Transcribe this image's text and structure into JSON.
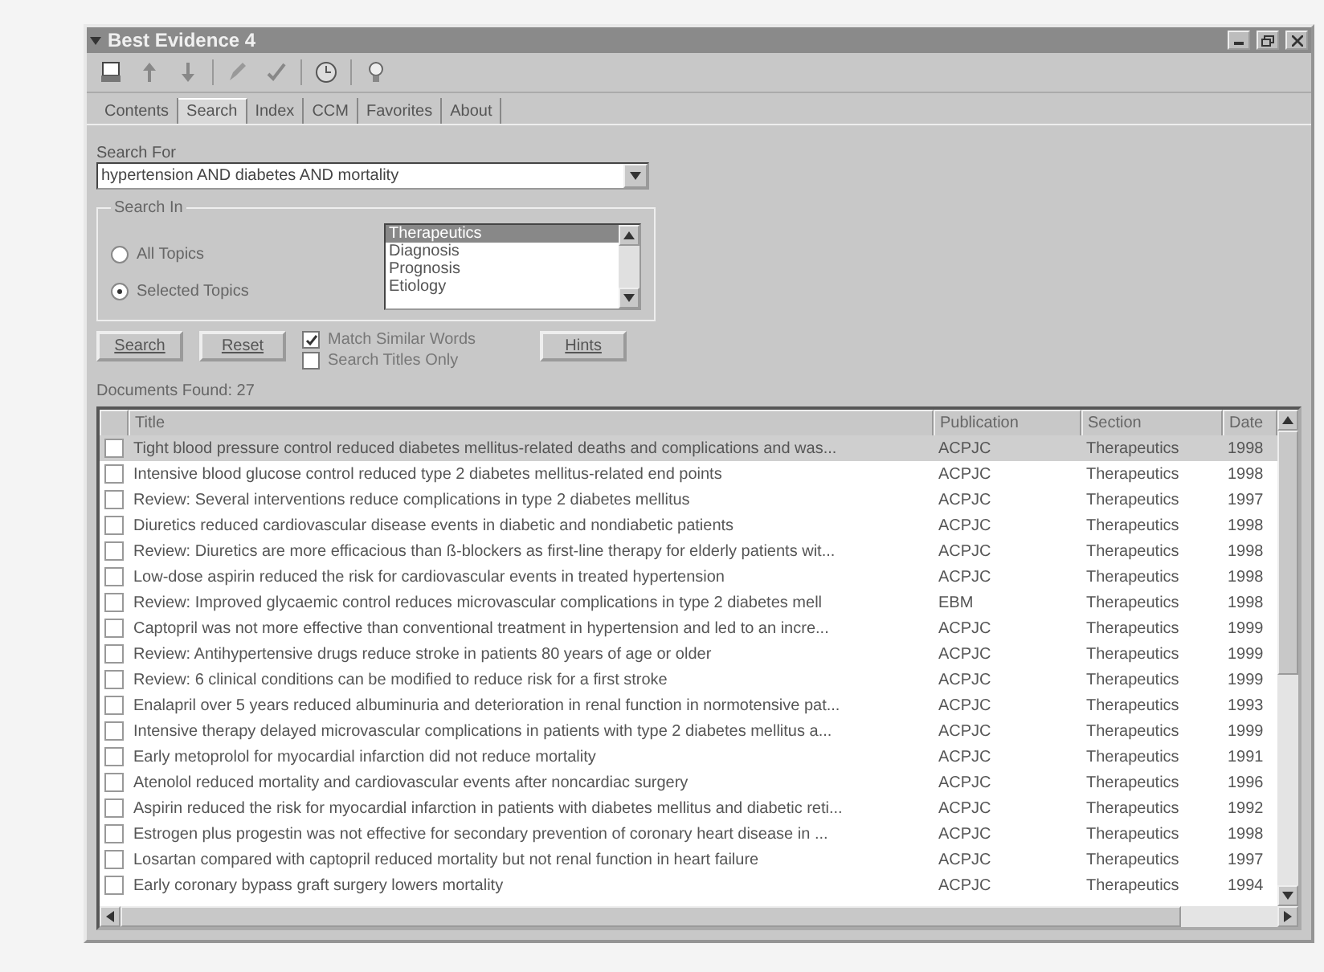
{
  "window": {
    "title": "Best Evidence 4"
  },
  "tabs": [
    {
      "label": "Contents",
      "selected": false
    },
    {
      "label": "Search",
      "selected": true
    },
    {
      "label": "Index",
      "selected": false
    },
    {
      "label": "CCM",
      "selected": false
    },
    {
      "label": "Favorites",
      "selected": false
    },
    {
      "label": "About",
      "selected": false
    }
  ],
  "search_for": {
    "label": "Search For",
    "value": "hypertension AND diabetes AND mortality"
  },
  "search_in": {
    "label": "Search In",
    "options": [
      {
        "label": "All Topics",
        "selected": false
      },
      {
        "label": "Selected Topics",
        "selected": true
      }
    ],
    "topics": [
      {
        "label": "Therapeutics",
        "selected": true
      },
      {
        "label": "Diagnosis",
        "selected": false
      },
      {
        "label": "Prognosis",
        "selected": false
      },
      {
        "label": "Etiology",
        "selected": false
      }
    ]
  },
  "buttons": [
    "Search",
    "Reset"
  ],
  "checkboxes": [
    {
      "label": "Match Similar Words",
      "checked": true
    },
    {
      "label": "Search Titles Only",
      "checked": false
    }
  ],
  "hints_button": "Hints",
  "documents_found": "Documents Found: 27",
  "table": {
    "columns": [
      "Title",
      "Publication",
      "Section",
      "Date"
    ],
    "rows": [
      {
        "selected": true,
        "checked": false,
        "cells": [
          "Tight blood pressure control reduced diabetes mellitus-related deaths and complications and was...",
          "ACPJC",
          "Therapeutics",
          "1998"
        ]
      },
      {
        "selected": false,
        "checked": false,
        "cells": [
          "Intensive blood glucose control reduced type 2 diabetes mellitus-related end points",
          "ACPJC",
          "Therapeutics",
          "1998"
        ]
      },
      {
        "selected": false,
        "checked": false,
        "cells": [
          "Review: Several interventions reduce complications in type 2 diabetes mellitus",
          "ACPJC",
          "Therapeutics",
          "1997"
        ]
      },
      {
        "selected": false,
        "checked": false,
        "cells": [
          "Diuretics reduced cardiovascular disease events in diabetic and nondiabetic patients",
          "ACPJC",
          "Therapeutics",
          "1998"
        ]
      },
      {
        "selected": false,
        "checked": false,
        "cells": [
          "Review: Diuretics are more efficacious than ß-blockers as first-line therapy for elderly patients wit...",
          "ACPJC",
          "Therapeutics",
          "1998"
        ]
      },
      {
        "selected": false,
        "checked": false,
        "cells": [
          "Low-dose aspirin reduced the risk for cardiovascular events in treated hypertension",
          "ACPJC",
          "Therapeutics",
          "1998"
        ]
      },
      {
        "selected": false,
        "checked": false,
        "cells": [
          "Review: Improved glycaemic control reduces microvascular complications in type 2 diabetes mell",
          "EBM",
          "Therapeutics",
          "1998"
        ]
      },
      {
        "selected": false,
        "checked": false,
        "cells": [
          "Captopril was not more effective than conventional treatment in hypertension and led to an incre...",
          "ACPJC",
          "Therapeutics",
          "1999"
        ]
      },
      {
        "selected": false,
        "checked": false,
        "cells": [
          "Review: Antihypertensive drugs reduce stroke in patients 80 years of age or older",
          "ACPJC",
          "Therapeutics",
          "1999"
        ]
      },
      {
        "selected": false,
        "checked": false,
        "cells": [
          "Review: 6 clinical conditions can be modified to reduce risk for a first stroke",
          "ACPJC",
          "Therapeutics",
          "1999"
        ]
      },
      {
        "selected": false,
        "checked": false,
        "cells": [
          "Enalapril over 5 years reduced albuminuria and deterioration in renal function in normotensive pat...",
          "ACPJC",
          "Therapeutics",
          "1993"
        ]
      },
      {
        "selected": false,
        "checked": false,
        "cells": [
          "Intensive therapy delayed microvascular complications in patients with type 2 diabetes mellitus a...",
          "ACPJC",
          "Therapeutics",
          "1999"
        ]
      },
      {
        "selected": false,
        "checked": false,
        "cells": [
          "Early metoprolol for myocardial infarction did not reduce mortality",
          "ACPJC",
          "Therapeutics",
          "1991"
        ]
      },
      {
        "selected": false,
        "checked": false,
        "cells": [
          "Atenolol reduced mortality and cardiovascular events after noncardiac surgery",
          "ACPJC",
          "Therapeutics",
          "1996"
        ]
      },
      {
        "selected": false,
        "checked": false,
        "cells": [
          "Aspirin reduced the risk for myocardial infarction in patients with diabetes mellitus and diabetic reti...",
          "ACPJC",
          "Therapeutics",
          "1992"
        ]
      },
      {
        "selected": false,
        "checked": false,
        "cells": [
          "Estrogen plus progestin was not effective for secondary prevention of coronary heart disease in ...",
          "ACPJC",
          "Therapeutics",
          "1998"
        ]
      },
      {
        "selected": false,
        "checked": false,
        "cells": [
          "Losartan compared with captopril reduced mortality but not renal function in heart failure",
          "ACPJC",
          "Therapeutics",
          "1997"
        ]
      },
      {
        "selected": false,
        "checked": false,
        "cells": [
          "Early coronary bypass graft surgery lowers mortality",
          "ACPJC",
          "Therapeutics",
          "1994"
        ]
      }
    ]
  }
}
